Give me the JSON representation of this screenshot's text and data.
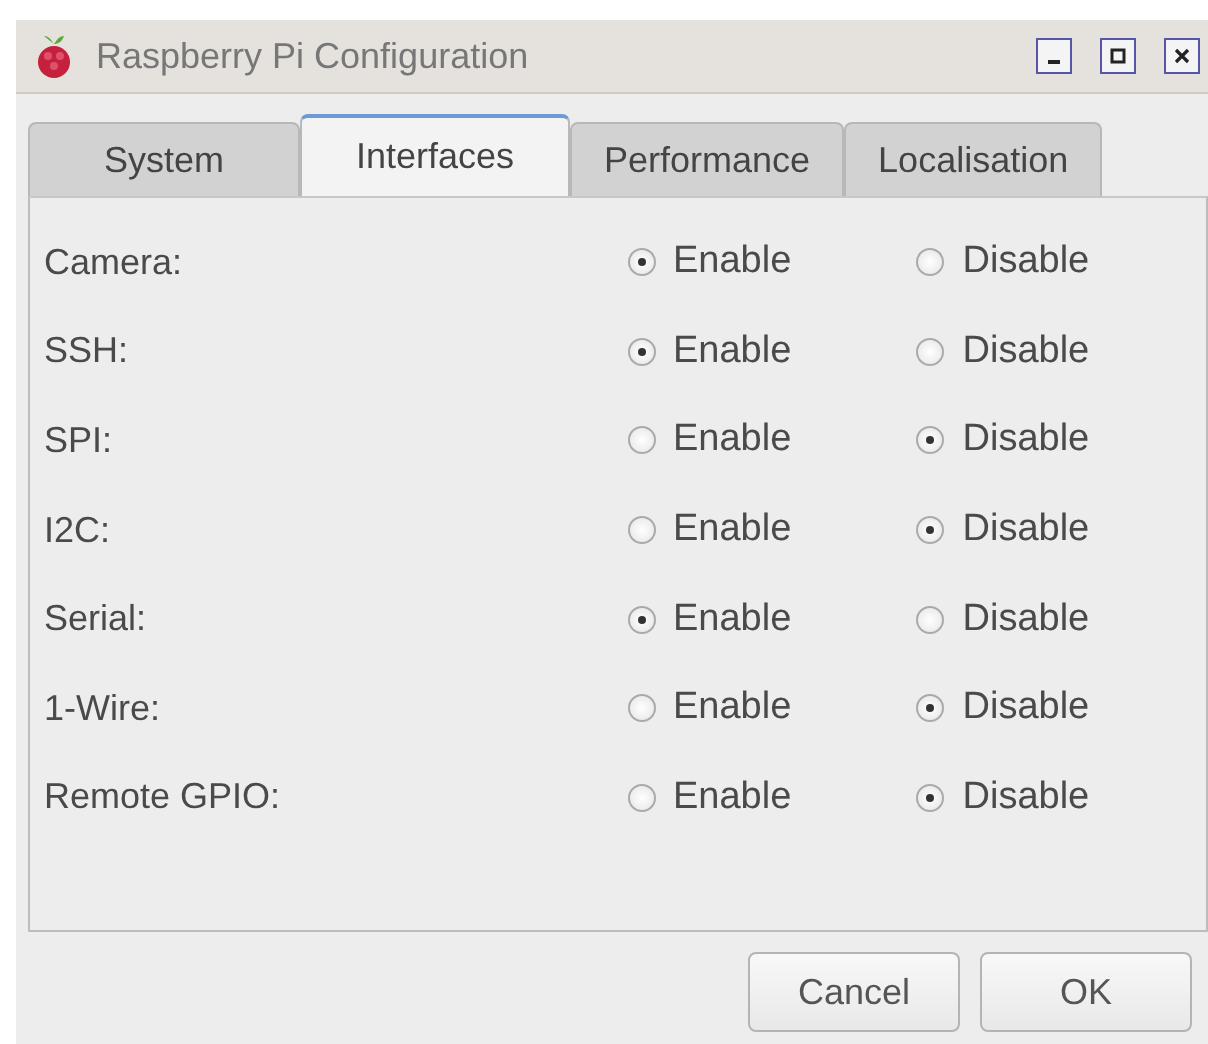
{
  "window": {
    "title": "Raspberry Pi Configuration"
  },
  "tabs": [
    {
      "label": "System",
      "selected": false
    },
    {
      "label": "Interfaces",
      "selected": true
    },
    {
      "label": "Performance",
      "selected": false
    },
    {
      "label": "Localisation",
      "selected": false
    }
  ],
  "settings": [
    {
      "label": "Camera:",
      "options": [
        {
          "label": "Enable",
          "selected": true
        },
        {
          "label": "Disable",
          "selected": false
        }
      ]
    },
    {
      "label": "SSH:",
      "options": [
        {
          "label": "Enable",
          "selected": true
        },
        {
          "label": "Disable",
          "selected": false
        }
      ]
    },
    {
      "label": "SPI:",
      "options": [
        {
          "label": "Enable",
          "selected": false
        },
        {
          "label": "Disable",
          "selected": true
        }
      ]
    },
    {
      "label": "I2C:",
      "options": [
        {
          "label": "Enable",
          "selected": false
        },
        {
          "label": "Disable",
          "selected": true
        }
      ]
    },
    {
      "label": "Serial:",
      "options": [
        {
          "label": "Enable",
          "selected": true
        },
        {
          "label": "Disable",
          "selected": false
        }
      ]
    },
    {
      "label": "1-Wire:",
      "options": [
        {
          "label": "Enable",
          "selected": false
        },
        {
          "label": "Disable",
          "selected": true
        }
      ]
    },
    {
      "label": "Remote GPIO:",
      "options": [
        {
          "label": "Enable",
          "selected": false
        },
        {
          "label": "Disable",
          "selected": true
        }
      ]
    }
  ],
  "buttons": [
    "Cancel",
    "OK"
  ]
}
